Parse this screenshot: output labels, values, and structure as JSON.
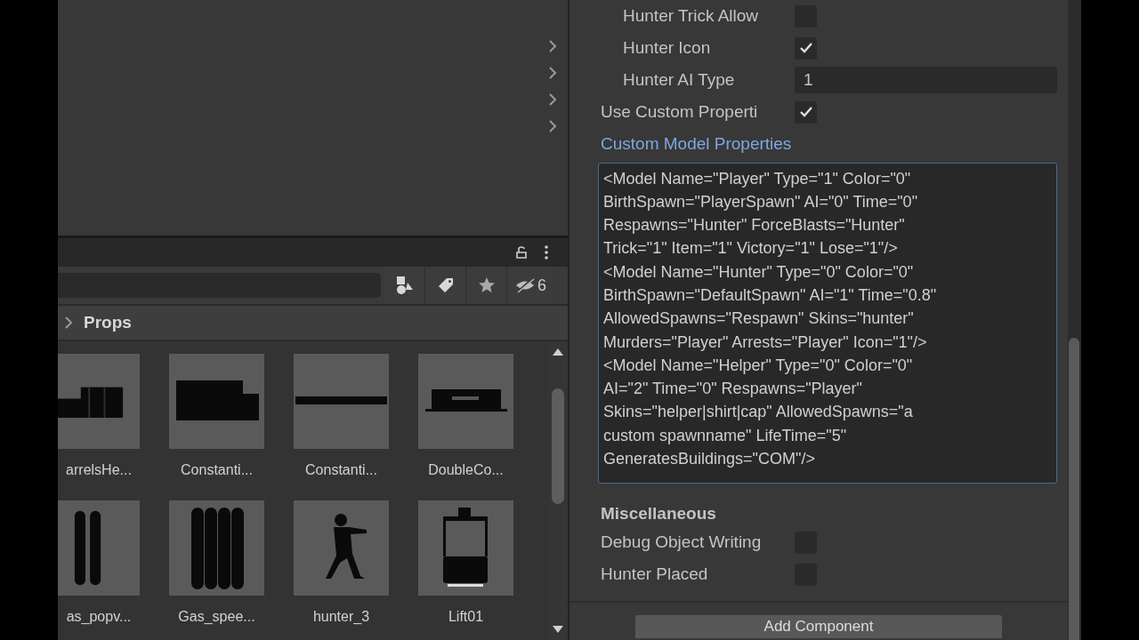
{
  "project": {
    "breadcrumb": "Props",
    "hidden_count": "6",
    "assets": [
      {
        "name": "arrelsHe...",
        "kind": "barrels"
      },
      {
        "name": "Constanti...",
        "kind": "blocks"
      },
      {
        "name": "Constanti...",
        "kind": "bar"
      },
      {
        "name": "DoubleCo...",
        "kind": "machine"
      },
      {
        "name": "as_popv...",
        "kind": "cylinders2"
      },
      {
        "name": "Gas_spee...",
        "kind": "cylinders4"
      },
      {
        "name": "hunter_3",
        "kind": "figure"
      },
      {
        "name": "Lift01",
        "kind": "lift"
      }
    ]
  },
  "inspector": {
    "fields": [
      {
        "label": "Hunter Trick Allow",
        "kind": "checkbox",
        "checked": false,
        "indent": true
      },
      {
        "label": "Hunter Icon",
        "kind": "checkbox",
        "checked": true,
        "indent": true
      },
      {
        "label": "Hunter AI Type",
        "kind": "text",
        "value": "1",
        "indent": true
      },
      {
        "label": "Use Custom Properti",
        "kind": "checkbox",
        "checked": true,
        "indent": false
      }
    ],
    "custom_label": "Custom Model Properties",
    "custom_lines": [
      "<Model Name=\"Player\" Type=\"1\" Color=\"0\"",
      "BirthSpawn=\"PlayerSpawn\" AI=\"0\" Time=\"0\"",
      "Respawns=\"Hunter\" ForceBlasts=\"Hunter\"",
      "Trick=\"1\" Item=\"1\" Victory=\"1\" Lose=\"1\"/>",
      "<Model Name=\"Hunter\" Type=\"0\" Color=\"0\"",
      "BirthSpawn=\"DefaultSpawn\" AI=\"1\" Time=\"0.8\"",
      "AllowedSpawns=\"Respawn\" Skins=\"hunter\"",
      "Murders=\"Player\" Arrests=\"Player\" Icon=\"1\"/>",
      "<Model Name=\"Helper\" Type=\"0\" Color=\"0\"",
      "AI=\"2\" Time=\"0\" Respawns=\"Player\"",
      "Skins=\"helper|shirt|cap\" AllowedSpawns=\"a",
      "custom spawnname\" LifeTime=\"5\"",
      "GeneratesBuildings=\"COM\"/>"
    ],
    "misc_heading": "Miscellaneous",
    "misc_fields": [
      {
        "label": "Debug Object Writing",
        "checked": false
      },
      {
        "label": "Hunter Placed",
        "checked": false
      }
    ],
    "add_button": "Add Component"
  }
}
